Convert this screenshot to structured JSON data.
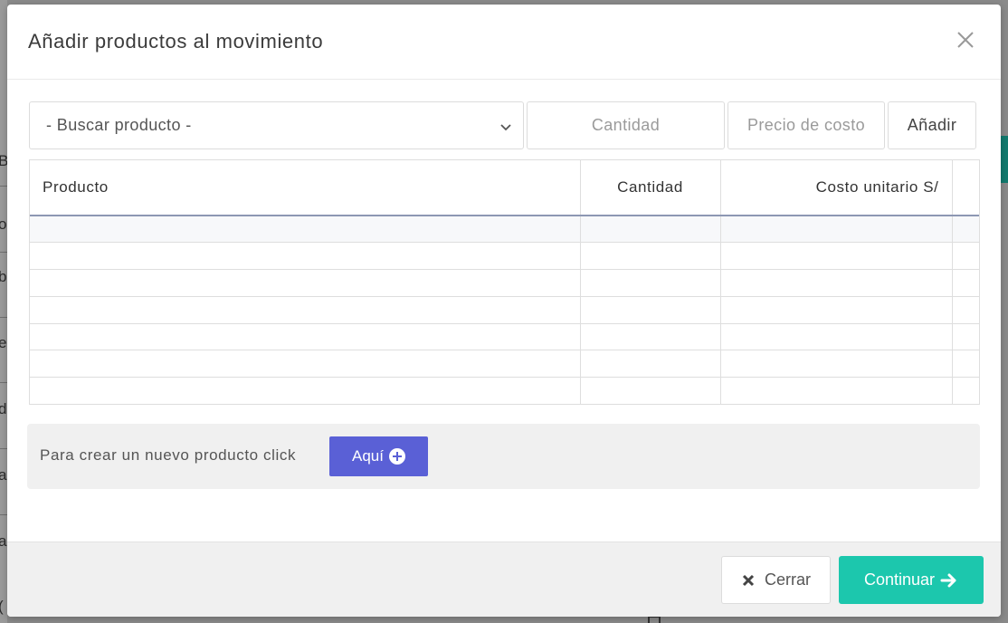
{
  "background": {
    "left_letters": [
      "B",
      "o",
      "b",
      "e",
      "d",
      "a",
      "a",
      "("
    ]
  },
  "modal": {
    "title": "Añadir productos al movimiento",
    "close_icon": "close-icon"
  },
  "search": {
    "product_select_value": "- Buscar producto -",
    "quantity_placeholder": "Cantidad",
    "price_placeholder": "Precio de costo",
    "add_label": "Añadir"
  },
  "table": {
    "headers": {
      "product": "Producto",
      "quantity": "Cantidad",
      "unit_cost": "Costo unitario S/"
    },
    "empty_rows": 7
  },
  "create_product": {
    "text": "Para crear un nuevo producto click",
    "button_label": "Aquí"
  },
  "footer": {
    "close_label": "Cerrar",
    "continue_label": "Continuar"
  },
  "colors": {
    "primary_button": "#5a60d6",
    "continue_button": "#1cc7ad",
    "header_underline": "#8d97b3"
  }
}
